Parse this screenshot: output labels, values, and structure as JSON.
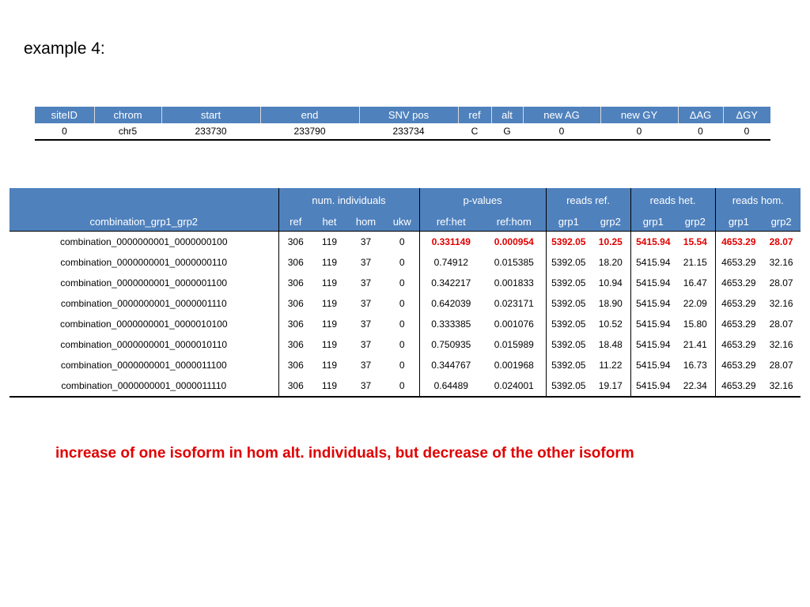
{
  "title": "example 4:",
  "table1": {
    "headers": [
      "siteID",
      "chrom",
      "start",
      "end",
      "SNV pos",
      "ref",
      "alt",
      "new AG",
      "new GY",
      "ΔAG",
      "ΔGY"
    ],
    "rows": [
      [
        "0",
        "chr5",
        "233730",
        "233790",
        "233734",
        "C",
        "G",
        "0",
        "0",
        "0",
        "0"
      ]
    ]
  },
  "table2": {
    "group_headers": {
      "num_individuals": "num. individuals",
      "p_values": "p-values",
      "reads_ref": "reads ref.",
      "reads_het": "reads het.",
      "reads_hom": "reads hom."
    },
    "sub_headers": {
      "combination": "combination_grp1_grp2",
      "ref": "ref",
      "het": "het",
      "hom": "hom",
      "ukw": "ukw",
      "ref_het": "ref:het",
      "ref_hom": "ref:hom",
      "ref_grp1": "grp1",
      "ref_grp2": "grp2",
      "het_grp1": "grp1",
      "het_grp2": "grp2",
      "hom_grp1": "grp1",
      "hom_grp2": "grp2"
    },
    "rows": [
      [
        "combination_0000000001_0000000100",
        "306",
        "119",
        "37",
        "0",
        "0.331149",
        "0.000954",
        "5392.05",
        "10.25",
        "5415.94",
        "15.54",
        "4653.29",
        "28.07"
      ],
      [
        "combination_0000000001_0000000110",
        "306",
        "119",
        "37",
        "0",
        "0.74912",
        "0.015385",
        "5392.05",
        "18.20",
        "5415.94",
        "21.15",
        "4653.29",
        "32.16"
      ],
      [
        "combination_0000000001_0000001100",
        "306",
        "119",
        "37",
        "0",
        "0.342217",
        "0.001833",
        "5392.05",
        "10.94",
        "5415.94",
        "16.47",
        "4653.29",
        "28.07"
      ],
      [
        "combination_0000000001_0000001110",
        "306",
        "119",
        "37",
        "0",
        "0.642039",
        "0.023171",
        "5392.05",
        "18.90",
        "5415.94",
        "22.09",
        "4653.29",
        "32.16"
      ],
      [
        "combination_0000000001_0000010100",
        "306",
        "119",
        "37",
        "0",
        "0.333385",
        "0.001076",
        "5392.05",
        "10.52",
        "5415.94",
        "15.80",
        "4653.29",
        "28.07"
      ],
      [
        "combination_0000000001_0000010110",
        "306",
        "119",
        "37",
        "0",
        "0.750935",
        "0.015989",
        "5392.05",
        "18.48",
        "5415.94",
        "21.41",
        "4653.29",
        "32.16"
      ],
      [
        "combination_0000000001_0000011100",
        "306",
        "119",
        "37",
        "0",
        "0.344767",
        "0.001968",
        "5392.05",
        "11.22",
        "5415.94",
        "16.73",
        "4653.29",
        "28.07"
      ],
      [
        "combination_0000000001_0000011110",
        "306",
        "119",
        "37",
        "0",
        "0.64489",
        "0.024001",
        "5392.05",
        "19.17",
        "5415.94",
        "22.34",
        "4653.29",
        "32.16"
      ]
    ]
  },
  "note": "increase of one isoform in hom alt. individuals, but decrease of the other isoform",
  "colors": {
    "header_bg": "#4f81bd",
    "highlight": "#e00000"
  }
}
